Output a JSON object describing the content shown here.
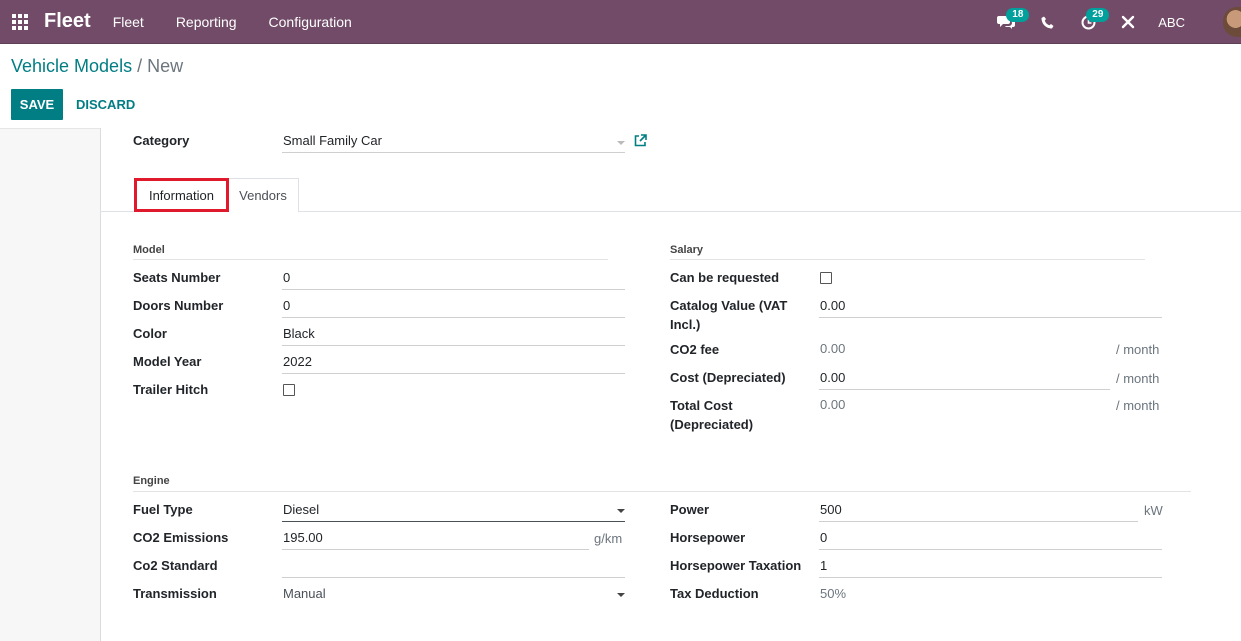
{
  "navbar": {
    "app_name": "Fleet",
    "menu": [
      "Fleet",
      "Reporting",
      "Configuration"
    ],
    "messages_count": "18",
    "activities_count": "29",
    "user_name": "ABC",
    "bg_color": "#714b67"
  },
  "breadcrumb": {
    "parent": "Vehicle Models",
    "separator": "/",
    "current": "New"
  },
  "buttons": {
    "save": "SAVE",
    "discard": "DISCARD"
  },
  "header_fields": {
    "category_label": "Category",
    "category_value": "Small Family Car"
  },
  "tabs": [
    {
      "label": "Information",
      "active": true
    },
    {
      "label": "Vendors",
      "active": false
    }
  ],
  "model_section": {
    "title": "Model",
    "seats_label": "Seats Number",
    "seats_value": "0",
    "doors_label": "Doors Number",
    "doors_value": "0",
    "color_label": "Color",
    "color_value": "Black",
    "year_label": "Model Year",
    "year_value": "2022",
    "trailer_label": "Trailer Hitch",
    "trailer_checked": false
  },
  "salary_section": {
    "title": "Salary",
    "requested_label": "Can be requested",
    "requested_checked": false,
    "catalog_label": "Catalog Value (VAT Incl.)",
    "catalog_value": "0.00",
    "co2fee_label": "CO2 fee",
    "co2fee_value": "0.00",
    "cost_label": "Cost (Depreciated)",
    "cost_value": "0.00",
    "total_label": "Total Cost (Depreciated)",
    "total_value": "0.00",
    "per_month": "/ month"
  },
  "engine_section": {
    "title": "Engine",
    "fuel_label": "Fuel Type",
    "fuel_value": "Diesel",
    "co2_label": "CO2 Emissions",
    "co2_value": "195.00",
    "co2_unit": "g/km",
    "co2std_label": "Co2 Standard",
    "co2std_value": "",
    "transmission_label": "Transmission",
    "transmission_value": "Manual",
    "power_label": "Power",
    "power_value": "500",
    "power_unit": "kW",
    "hp_label": "Horsepower",
    "hp_value": "0",
    "hptax_label": "Horsepower Taxation",
    "hptax_value": "1",
    "taxded_label": "Tax Deduction",
    "taxded_value": "50%"
  }
}
